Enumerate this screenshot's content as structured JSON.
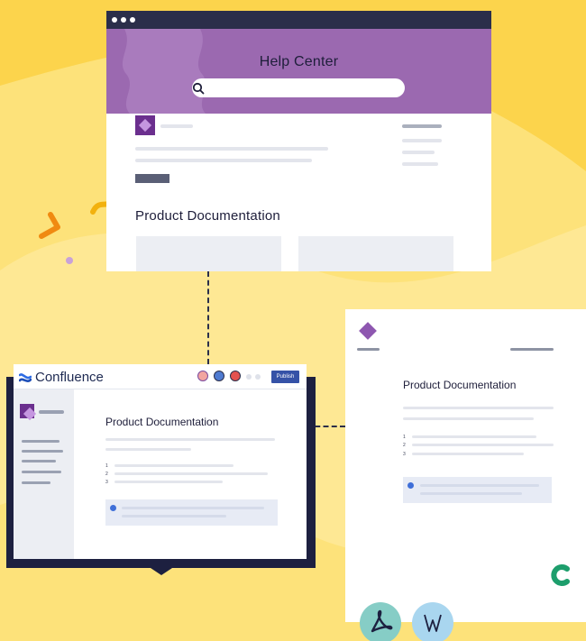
{
  "help_center": {
    "title": "Help Center",
    "section_title": "Product Documentation"
  },
  "confluence": {
    "brand": "Confluence",
    "publish_label": "Publish",
    "page_title": "Product Documentation",
    "list_numbers": [
      "1",
      "2",
      "3"
    ]
  },
  "export_doc": {
    "title": "Product Documentation",
    "list_numbers": [
      "1",
      "2",
      "3"
    ]
  },
  "icons": [
    "search-icon",
    "confluence-logo-icon",
    "pdf-icon",
    "word-icon",
    "brand-logo-icon"
  ],
  "colors": {
    "background": "#fcd44c",
    "accent_purple": "#9b69b0",
    "dark_navy": "#2b2e4a",
    "publish_blue": "#3552a7",
    "pdf_teal": "#86cdc6",
    "word_blue": "#a9d6ef",
    "brand_green": "#1d9e6c"
  }
}
